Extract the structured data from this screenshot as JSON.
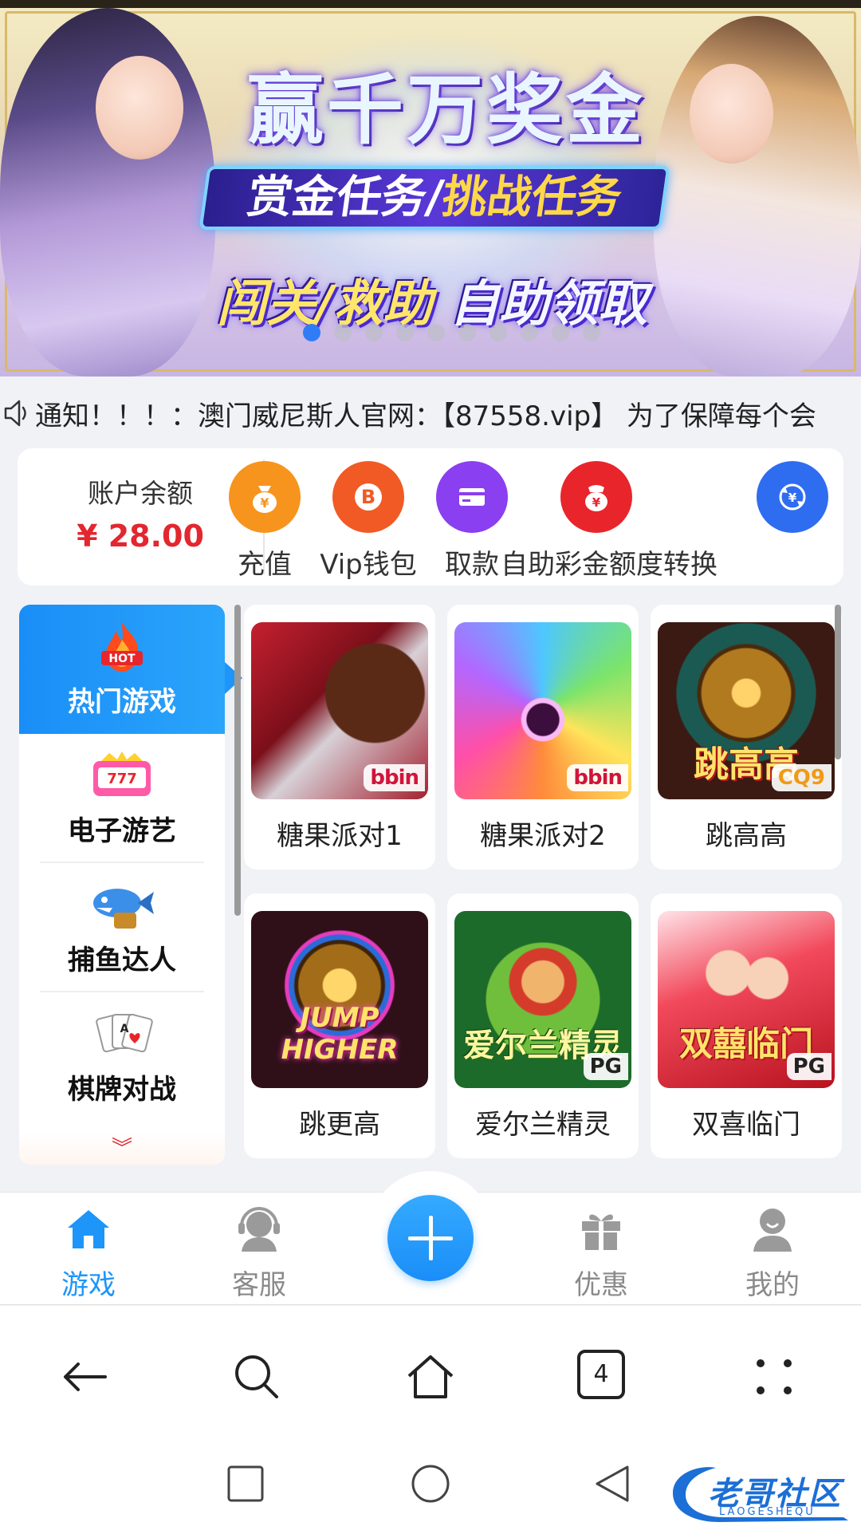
{
  "banner": {
    "title": "赢千万奖金",
    "subtitle_a": "赏金任务/",
    "subtitle_b": "挑战任务",
    "slogan_a": "闯关/救助 ",
    "slogan_b": "自助领取",
    "slide_count": 10,
    "active_slide": 0
  },
  "notice": {
    "text": "通知！！！：澳门威尼斯人官网：【87558.vip】 为了保障每个会"
  },
  "account": {
    "balance_label": "账户余额",
    "balance_value": "¥ 28.00",
    "actions": [
      {
        "label": "充值",
        "icon": "moneybag-icon",
        "color": "#f7941d"
      },
      {
        "label": "Vip钱包",
        "icon": "bitcoin-icon",
        "color": "#f15a24"
      },
      {
        "label": "取款",
        "icon": "card-icon",
        "color": "#8a3ff0"
      },
      {
        "label": "自助彩金额度转换",
        "icon": "redbag-icon",
        "color": "#e8252b"
      },
      {
        "label": "",
        "icon": "exchange-icon",
        "color": "#2f6df0"
      }
    ]
  },
  "categories": [
    {
      "label": "热门游戏",
      "icon": "hot-flame-icon",
      "active": true
    },
    {
      "label": "电子游艺",
      "icon": "slot-machine-icon",
      "active": false
    },
    {
      "label": "捕鱼达人",
      "icon": "fish-icon",
      "active": false
    },
    {
      "label": "棋牌对战",
      "icon": "playing-cards-icon",
      "active": false
    }
  ],
  "games": [
    {
      "name": "糖果派对1",
      "provider": "bbin"
    },
    {
      "name": "糖果派对2",
      "provider": "bbin"
    },
    {
      "name": "跳高高",
      "provider": "CQ9",
      "art_text": "跳高高"
    },
    {
      "name": "跳更高",
      "provider": "",
      "art_text": "JUMP HIGHER"
    },
    {
      "name": "爱尔兰精灵",
      "provider": "PG",
      "art_text": "爱尔兰精灵"
    },
    {
      "name": "双喜临门",
      "provider": "PG",
      "art_text": "双囍临门"
    }
  ],
  "bottom_nav": [
    {
      "label": "游戏",
      "icon": "home-icon",
      "active": true
    },
    {
      "label": "客服",
      "icon": "headset-icon",
      "active": false
    },
    {
      "label": "",
      "icon": "plus-icon",
      "active": false
    },
    {
      "label": "优惠",
      "icon": "gift-icon",
      "active": false
    },
    {
      "label": "我的",
      "icon": "user-icon",
      "active": false
    }
  ],
  "browser": {
    "tab_count": "4"
  },
  "watermark": {
    "text": "老哥社区",
    "sub": "LAOGESHEQU"
  },
  "colors": {
    "accent": "#1e95f8",
    "price": "#e3262f",
    "nav_inactive": "#8a8a8a"
  }
}
